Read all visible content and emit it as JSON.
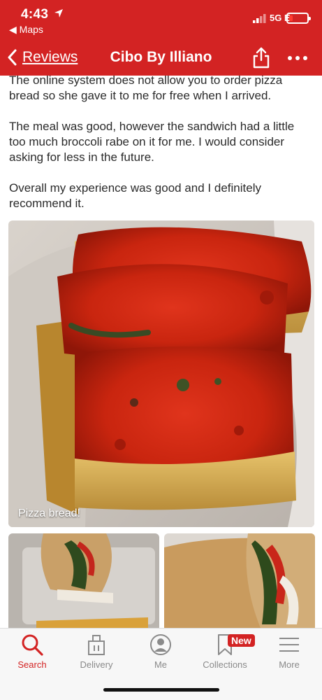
{
  "status_bar": {
    "time": "4:43",
    "back_app": "◀ Maps",
    "network": "5G E"
  },
  "header": {
    "back_label": "Reviews",
    "title": "Cibo By Illiano"
  },
  "review": {
    "paragraphs": [
      "The online system does not allow you to order pizza bread so she gave it to me for free when I arrived.",
      "The meal was good, however the sandwich had a little too much broccoli rabe on it for me. I would consider asking for less in the future.",
      "Overall my experience was good and I definitely recommend it."
    ]
  },
  "photos": {
    "main_caption": "Pizza bread!"
  },
  "tabbar": {
    "items": [
      {
        "label": "Search",
        "icon": "search-icon",
        "active": true
      },
      {
        "label": "Delivery",
        "icon": "delivery-bag-icon"
      },
      {
        "label": "Me",
        "icon": "profile-icon"
      },
      {
        "label": "Collections",
        "icon": "bookmark-icon",
        "badge": "New"
      },
      {
        "label": "More",
        "icon": "menu-icon"
      }
    ]
  },
  "colors": {
    "brand_red": "#d32323",
    "tab_inactive": "#8a8a8a"
  }
}
